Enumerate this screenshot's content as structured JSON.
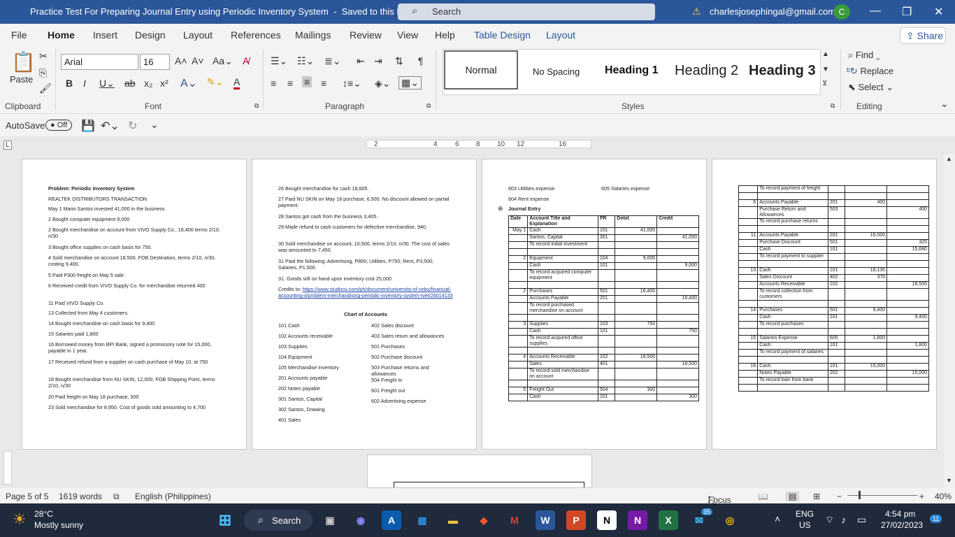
{
  "window": {
    "doc_title": "Practice Test For Preparing Journal Entry using Periodic Inventory System",
    "saved": "Saved to this PC",
    "search": "Search",
    "account": "charlesjosephingal@gmail.com",
    "avatar": "C"
  },
  "menu": [
    "File",
    "Home",
    "Insert",
    "Design",
    "Layout",
    "References",
    "Mailings",
    "Review",
    "View",
    "Help",
    "Table Design",
    "Layout"
  ],
  "share": "Share",
  "ribbon": {
    "paste": "Paste",
    "clipboard": "Clipboard",
    "font": "Font",
    "font_name": "Arial",
    "font_size": "16",
    "paragraph": "Paragraph",
    "styles": "Styles",
    "style_normal": "Normal",
    "style_nospacing": "No Spacing",
    "style_h1": "Heading 1",
    "style_h2": "Heading 2",
    "style_h3": "Heading 3",
    "editing": "Editing",
    "find": "Find",
    "replace": "Replace",
    "select": "Select"
  },
  "quick": {
    "autosave": "AutoSave",
    "off": "Off"
  },
  "ruler": [
    "2",
    "2",
    "4",
    "6",
    "8",
    "10",
    "12",
    "14",
    "16",
    "18"
  ],
  "page1": {
    "title": "Problem: Periodic Inventory System",
    "company": "REALTEK DISTRIBUTORS TRANSACTION",
    "lines": [
      "May 1 Mario Santos invested 41,000 in the business",
      "2   Bought computer equipment 9,000",
      "2   Bought merchandise on account from VIVO Supply Co., 16,400 terms 2/10, n/30",
      "3   Bought office supplies on cash basis for 750.",
      "4   Sold merchandise on account 18,500, FOB Destination, terms 2/10, n/30, costing 9,400.",
      "5   Paid P300 freight on May 5 sale.",
      "6  Received credit from VIVO Supply Co. for merchandise returned 400",
      "11   Paid VIVO Supply Co.",
      "13   Collected from May 4 customers.",
      "14   Bought merchandise on cash basis for 9,400",
      "15   Salaries paid 1,800",
      "16   Borrowed money from BPI Bank, signed a promissory note for 15,000, payable in 1 year.",
      "17   Received refund from a supplier on cash purchase of May 10, at 750",
      "18   Bought merchandise from NU SKIN, 12,000, FOB Shipping Point, terms 2/10, n/30",
      "20   Paid freight on May 18 purchase, 500",
      "23   Sold merchandise for 8,950. Cost of goods sold amounting to 4,700"
    ]
  },
  "page2": {
    "lines": [
      "26   Bought merchandise for cash 18,605.",
      "27   Paid NU SKIN on May 18 purchase, 6,500. No discount allowed on partial payment.",
      "28   Santos got cash from the business 3,405.",
      "29   Made refund to cash customers for defective merchandise, 940.",
      "30   Sold merchandise on account, 10,500, terms 2/10, n/30. The cost of sales was amounted to 7,450.",
      "31   Paid the following: Advertising, P800; Utilities, P750; Rent, P3,500; Salaries, P1,500.",
      "31. Goods still on hand upon inventory cost 25,000"
    ],
    "credits_label": "Credits to:",
    "credits_url": "https://www.studocu.com/ph/document/university-of-cebu/financial-accounting-ii/problem-merchandising-periodic-inventory-system-tvet/26014133",
    "coa_title": "Chart of Accounts",
    "coa_left": [
      "101  Cash",
      "102  Accounts receivable",
      "103  Supplies",
      "104  Equipment",
      "105  Merchandise Inventory",
      "201  Accounts payable",
      "202  Notes payable",
      "301  Santos, Capital",
      "302  Santos, Drawing",
      "401  Sales"
    ],
    "coa_right": [
      "402  Sales discount",
      "403  Sales return and allowances",
      "501  Purchases",
      "502  Purchase discount",
      "503  Purchase returns and allowances",
      "504  Freight In",
      "601  Freight out",
      "602  Advertising expense"
    ]
  },
  "page3": {
    "top": [
      "603  Utilities expense",
      "605  Salaries expense",
      "604  Rent expense"
    ],
    "je_title": "Journal Entry",
    "headers": [
      "Date",
      "Account Title and Explanation",
      "PR",
      "Debit",
      "Credit"
    ],
    "rows": [
      [
        "May 1",
        "Cash",
        "101",
        "41,000",
        ""
      ],
      [
        "",
        "Santos, Capital",
        "301",
        "",
        "41,000"
      ],
      [
        "",
        "To record initial investment",
        "",
        "",
        ""
      ],
      [
        "",
        "",
        "",
        "",
        ""
      ],
      [
        "2",
        "Equipment",
        "104",
        "9,000",
        ""
      ],
      [
        "",
        "Cash",
        "101",
        "",
        "9,000"
      ],
      [
        "",
        "To record acquired computer equipment",
        "",
        "",
        ""
      ],
      [
        "",
        "",
        "",
        "",
        ""
      ],
      [
        "2",
        "Purchases",
        "501",
        "16,400",
        ""
      ],
      [
        "",
        "Accounts Payable",
        "201",
        "",
        "16,400"
      ],
      [
        "",
        "To record purchased merchandise on account",
        "",
        "",
        ""
      ],
      [
        "",
        "",
        "",
        "",
        ""
      ],
      [
        "3",
        "Supplies",
        "103",
        "750",
        ""
      ],
      [
        "",
        "Cash",
        "101",
        "",
        "750"
      ],
      [
        "",
        "To record acquired office supplies",
        "",
        "",
        ""
      ],
      [
        "",
        "",
        "",
        "",
        ""
      ],
      [
        "4",
        "Accounts Receivable",
        "102",
        "18,500",
        ""
      ],
      [
        "",
        "Sales",
        "401",
        "",
        "18,500"
      ],
      [
        "",
        "To record sold merchandise on account",
        "",
        "",
        ""
      ],
      [
        "",
        "",
        "",
        "",
        ""
      ],
      [
        "5",
        "Freight Out",
        "504",
        "300",
        ""
      ],
      [
        "",
        "Cash",
        "101",
        "",
        "300"
      ]
    ]
  },
  "page4": {
    "rows": [
      [
        "",
        "To record payment of freight",
        "",
        "",
        ""
      ],
      [
        "",
        "",
        "",
        "",
        ""
      ],
      [
        "6",
        "Accounts Payable",
        "201",
        "400",
        ""
      ],
      [
        "",
        "Purchase Return and Allowances",
        "503",
        "",
        "400"
      ],
      [
        "",
        "To record purchase returns",
        "",
        "",
        ""
      ],
      [
        "",
        "",
        "",
        "",
        ""
      ],
      [
        "11",
        "Accounts Payable",
        "201",
        "16,000",
        ""
      ],
      [
        "",
        "Purchase Discount",
        "501",
        "",
        "320"
      ],
      [
        "",
        "Cash",
        "101",
        "",
        "15,680"
      ],
      [
        "",
        "To record payment to supplier",
        "",
        "",
        ""
      ],
      [
        "",
        "",
        "",
        "",
        ""
      ],
      [
        "13",
        "Cash",
        "101",
        "18,130",
        ""
      ],
      [
        "",
        "Sales Discount",
        "402",
        "370",
        ""
      ],
      [
        "",
        "Accounts Receivable",
        "102",
        "",
        "18,500"
      ],
      [
        "",
        "To record collection from customers",
        "",
        "",
        ""
      ],
      [
        "",
        "",
        "",
        "",
        ""
      ],
      [
        "14",
        "Purchases",
        "501",
        "9,400",
        ""
      ],
      [
        "",
        "Cash",
        "101",
        "",
        "9,400"
      ],
      [
        "",
        "To record purchases",
        "",
        "",
        ""
      ],
      [
        "",
        "",
        "",
        "",
        ""
      ],
      [
        "15",
        "Salaries Expense",
        "605",
        "1,800",
        ""
      ],
      [
        "",
        "Cash",
        "101",
        "",
        "1,800"
      ],
      [
        "",
        "To record payment of salaries",
        "",
        "",
        ""
      ],
      [
        "",
        "",
        "",
        "",
        ""
      ],
      [
        "16",
        "Cash",
        "101",
        "15,000",
        ""
      ],
      [
        "",
        "Notes Payable",
        "202",
        "",
        "15,000"
      ],
      [
        "",
        "To record loan from bank",
        "",
        "",
        ""
      ],
      [
        "",
        "",
        "",
        "",
        ""
      ]
    ]
  },
  "status": {
    "page": "Page 5 of 5",
    "words": "1619 words",
    "language": "English (Philippines)",
    "focus": "Focus",
    "zoom": "40%"
  },
  "taskbar": {
    "temp": "28°C",
    "weather": "Mostly sunny",
    "search": "Search",
    "lang1": "ENG",
    "lang2": "US",
    "time": "4:54 pm",
    "date": "27/02/2023",
    "badge": "35",
    "notif": "11"
  }
}
